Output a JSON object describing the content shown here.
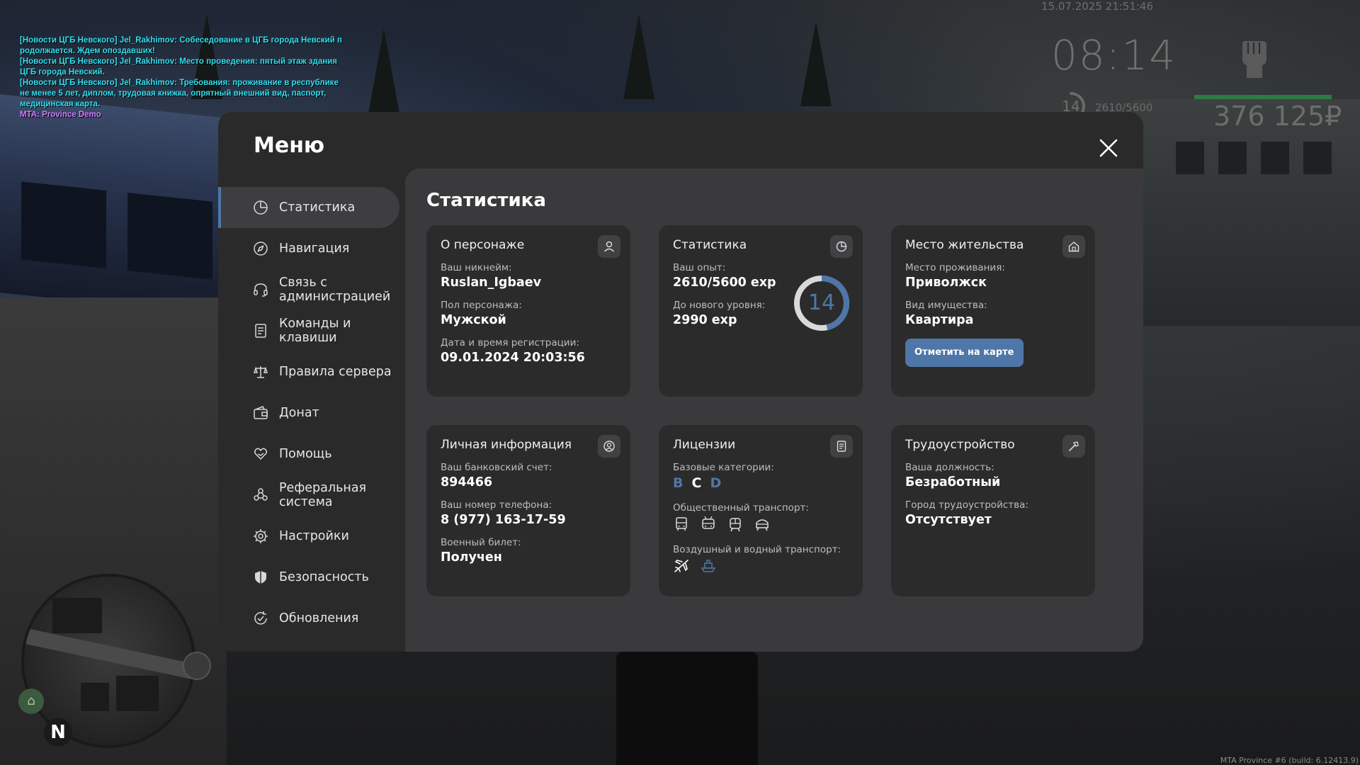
{
  "chat": [
    {
      "text": "[Новости ЦГБ Невского] Jel_Rakhimov: Собеседование в ЦГБ города Невский п",
      "kind": "news"
    },
    {
      "text": "родолжается. Ждем опоздавших!",
      "kind": "news"
    },
    {
      "text": "[Новости ЦГБ Невского] Jel_Rakhimov: Место проведения: пятый этаж здания",
      "kind": "news"
    },
    {
      "text": "ЦГБ города Невский.",
      "kind": "news"
    },
    {
      "text": "[Новости ЦГБ Невского] Jel_Rakhimov: Требования: проживание в республике",
      "kind": "news"
    },
    {
      "text": "не менее 5 лет, диплом, трудовая книжка, опрятный внешний вид, паспорт,",
      "kind": "news"
    },
    {
      "text": "медицинская карта.",
      "kind": "news"
    },
    {
      "text": "MTA: Province Demo",
      "kind": "mta"
    }
  ],
  "hud": {
    "datetime": "15.07.2025 21:51:46",
    "clock": "08:14",
    "level": "14",
    "exp": "2610/5600",
    "money": "376 125₽",
    "health_fraction": 1.0
  },
  "build_info": "MTA Province #6 (build: 6.12413.9)",
  "minimap": {
    "north": "N"
  },
  "menu": {
    "title": "Меню",
    "nav": [
      {
        "id": "stats",
        "label": "Статистика",
        "icon": "pie-chart-icon",
        "active": true
      },
      {
        "id": "navigation",
        "label": "Навигация",
        "icon": "compass-icon",
        "active": false
      },
      {
        "id": "contact-admin",
        "label": "Связь с\nадминистрацией",
        "icon": "headset-icon",
        "active": false
      },
      {
        "id": "commands",
        "label": "Команды и\nклавиши",
        "icon": "document-icon",
        "active": false
      },
      {
        "id": "rules",
        "label": "Правила сервера",
        "icon": "scales-icon",
        "active": false
      },
      {
        "id": "donate",
        "label": "Донат",
        "icon": "wallet-icon",
        "active": false
      },
      {
        "id": "help",
        "label": "Помощь",
        "icon": "heart-hand-icon",
        "active": false
      },
      {
        "id": "referral",
        "label": "Реферальная\nсистема",
        "icon": "people-icon",
        "active": false
      },
      {
        "id": "settings",
        "label": "Настройки",
        "icon": "gear-icon",
        "active": false
      },
      {
        "id": "security",
        "label": "Безопасность",
        "icon": "shield-icon",
        "active": false
      },
      {
        "id": "updates",
        "label": "Обновления",
        "icon": "refresh-check-icon",
        "active": false
      }
    ]
  },
  "content": {
    "title": "Статистика",
    "character": {
      "title": "О персонаже",
      "nickname_label": "Ваш никнейм:",
      "nickname": "Ruslan_Igbaev",
      "gender_label": "Пол персонажа:",
      "gender": "Мужской",
      "reg_label": "Дата и время регистрации:",
      "reg": "09.01.2024 20:03:56"
    },
    "stats": {
      "title": "Статистика",
      "exp_label": "Ваш опыт:",
      "exp": "2610/5600 exp",
      "next_label": "До нового уровня:",
      "next": "2990 exp",
      "level": "14",
      "progress_fraction": 0.466
    },
    "residence": {
      "title": "Место жительства",
      "place_label": "Место проживания:",
      "place": "Приволжск",
      "property_label": "Вид имущества:",
      "property": "Квартира",
      "map_button": "Отметить на карте"
    },
    "personal": {
      "title": "Личная информация",
      "bank_label": "Ваш банковский счет:",
      "bank": "894466",
      "phone_label": "Ваш номер телефона:",
      "phone": "8 (977) 163-17-59",
      "military_label": "Военный билет:",
      "military": "Получен"
    },
    "licenses": {
      "title": "Лицензии",
      "base_label": "Базовые категории:",
      "categories": [
        {
          "letter": "B",
          "owned": true
        },
        {
          "letter": "C",
          "owned": false
        },
        {
          "letter": "D",
          "owned": true
        }
      ],
      "public_label": "Общественный транспорт:",
      "public_icons": [
        "bus-icon",
        "trolleybus-icon",
        "tram-icon",
        "metro-icon"
      ],
      "air_label": "Воздушный и водный транспорт:",
      "air_icons": [
        "plane-icon",
        "ship-icon"
      ]
    },
    "employment": {
      "title": "Трудоустройство",
      "position_label": "Ваша должность:",
      "position": "Безработный",
      "city_label": "Город трудоустройства:",
      "city": "Отсутствует"
    }
  }
}
